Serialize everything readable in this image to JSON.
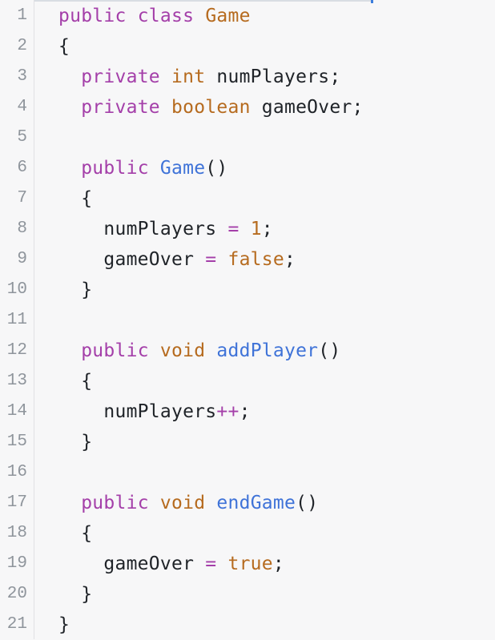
{
  "editor": {
    "lines": [
      {
        "number": "1",
        "tokens": [
          {
            "text": "public",
            "kind": "keyword"
          },
          {
            "text": " ",
            "kind": "plain"
          },
          {
            "text": "class",
            "kind": "keyword"
          },
          {
            "text": " ",
            "kind": "plain"
          },
          {
            "text": "Game",
            "kind": "type"
          }
        ]
      },
      {
        "number": "2",
        "tokens": [
          {
            "text": "{",
            "kind": "plain"
          }
        ]
      },
      {
        "number": "3",
        "tokens": [
          {
            "text": "  ",
            "kind": "plain"
          },
          {
            "text": "private",
            "kind": "keyword"
          },
          {
            "text": " ",
            "kind": "plain"
          },
          {
            "text": "int",
            "kind": "type"
          },
          {
            "text": " numPlayers;",
            "kind": "plain"
          }
        ]
      },
      {
        "number": "4",
        "tokens": [
          {
            "text": "  ",
            "kind": "plain"
          },
          {
            "text": "private",
            "kind": "keyword"
          },
          {
            "text": " ",
            "kind": "plain"
          },
          {
            "text": "boolean",
            "kind": "type"
          },
          {
            "text": " gameOver;",
            "kind": "plain"
          }
        ]
      },
      {
        "number": "5",
        "tokens": []
      },
      {
        "number": "6",
        "tokens": [
          {
            "text": "  ",
            "kind": "plain"
          },
          {
            "text": "public",
            "kind": "keyword"
          },
          {
            "text": " ",
            "kind": "plain"
          },
          {
            "text": "Game",
            "kind": "function"
          },
          {
            "text": "()",
            "kind": "plain"
          }
        ]
      },
      {
        "number": "7",
        "tokens": [
          {
            "text": "  {",
            "kind": "plain"
          }
        ]
      },
      {
        "number": "8",
        "tokens": [
          {
            "text": "    numPlayers ",
            "kind": "plain"
          },
          {
            "text": "=",
            "kind": "operator"
          },
          {
            "text": " ",
            "kind": "plain"
          },
          {
            "text": "1",
            "kind": "number"
          },
          {
            "text": ";",
            "kind": "plain"
          }
        ]
      },
      {
        "number": "9",
        "tokens": [
          {
            "text": "    gameOver ",
            "kind": "plain"
          },
          {
            "text": "=",
            "kind": "operator"
          },
          {
            "text": " ",
            "kind": "plain"
          },
          {
            "text": "false",
            "kind": "type"
          },
          {
            "text": ";",
            "kind": "plain"
          }
        ]
      },
      {
        "number": "10",
        "tokens": [
          {
            "text": "  }",
            "kind": "plain"
          }
        ]
      },
      {
        "number": "11",
        "tokens": []
      },
      {
        "number": "12",
        "tokens": [
          {
            "text": "  ",
            "kind": "plain"
          },
          {
            "text": "public",
            "kind": "keyword"
          },
          {
            "text": " ",
            "kind": "plain"
          },
          {
            "text": "void",
            "kind": "type"
          },
          {
            "text": " ",
            "kind": "plain"
          },
          {
            "text": "addPlayer",
            "kind": "function"
          },
          {
            "text": "()",
            "kind": "plain"
          }
        ]
      },
      {
        "number": "13",
        "tokens": [
          {
            "text": "  {",
            "kind": "plain"
          }
        ]
      },
      {
        "number": "14",
        "tokens": [
          {
            "text": "    numPlayers",
            "kind": "plain"
          },
          {
            "text": "++",
            "kind": "operator"
          },
          {
            "text": ";",
            "kind": "plain"
          }
        ]
      },
      {
        "number": "15",
        "tokens": [
          {
            "text": "  }",
            "kind": "plain"
          }
        ]
      },
      {
        "number": "16",
        "tokens": []
      },
      {
        "number": "17",
        "tokens": [
          {
            "text": "  ",
            "kind": "plain"
          },
          {
            "text": "public",
            "kind": "keyword"
          },
          {
            "text": " ",
            "kind": "plain"
          },
          {
            "text": "void",
            "kind": "type"
          },
          {
            "text": " ",
            "kind": "plain"
          },
          {
            "text": "endGame",
            "kind": "function"
          },
          {
            "text": "()",
            "kind": "plain"
          }
        ]
      },
      {
        "number": "18",
        "tokens": [
          {
            "text": "  {",
            "kind": "plain"
          }
        ]
      },
      {
        "number": "19",
        "tokens": [
          {
            "text": "    gameOver ",
            "kind": "plain"
          },
          {
            "text": "=",
            "kind": "operator"
          },
          {
            "text": " ",
            "kind": "plain"
          },
          {
            "text": "true",
            "kind": "type"
          },
          {
            "text": ";",
            "kind": "plain"
          }
        ]
      },
      {
        "number": "20",
        "tokens": [
          {
            "text": "  }",
            "kind": "plain"
          }
        ]
      },
      {
        "number": "21",
        "tokens": [
          {
            "text": "}",
            "kind": "plain"
          }
        ]
      }
    ]
  },
  "colors": {
    "background": "#f7f7f8",
    "keyword": "#a43fa9",
    "type": "#b66b1f",
    "function": "#3f73d8",
    "plain": "#1f2328",
    "line_number": "#8f959c",
    "accent": "#3b7ddd"
  }
}
